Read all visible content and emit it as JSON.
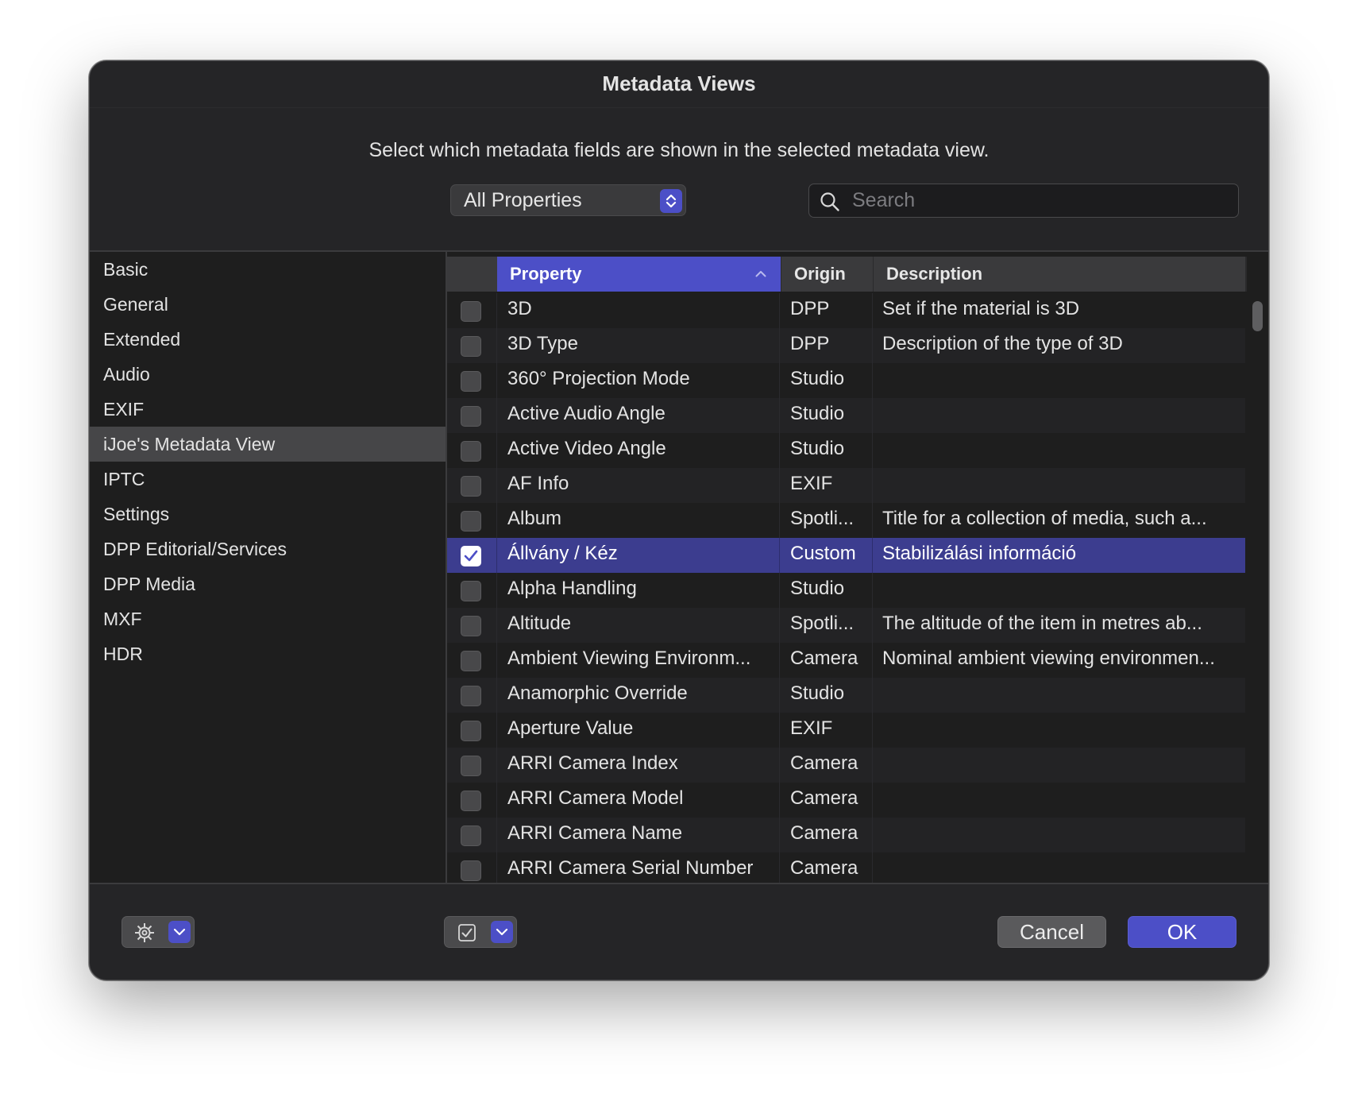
{
  "window": {
    "title": "Metadata Views",
    "instruction": "Select which metadata fields are shown in the selected metadata view."
  },
  "filter_popup": {
    "selected": "All Properties"
  },
  "search": {
    "placeholder": "Search",
    "value": ""
  },
  "sidebar": {
    "selected_index": 5,
    "items": [
      {
        "label": "Basic"
      },
      {
        "label": "General"
      },
      {
        "label": "Extended"
      },
      {
        "label": "Audio"
      },
      {
        "label": "EXIF"
      },
      {
        "label": "iJoe's Metadata View"
      },
      {
        "label": "IPTC"
      },
      {
        "label": "Settings"
      },
      {
        "label": "DPP Editorial/Services"
      },
      {
        "label": "DPP Media"
      },
      {
        "label": "MXF"
      },
      {
        "label": "HDR"
      }
    ]
  },
  "table": {
    "columns": {
      "property": "Property",
      "origin": "Origin",
      "description": "Description"
    },
    "sort": {
      "column": "property",
      "direction": "ascending"
    },
    "rows": [
      {
        "checked": false,
        "property": "3D",
        "origin": "DPP",
        "description": "Set if the material is 3D"
      },
      {
        "checked": false,
        "property": "3D Type",
        "origin": "DPP",
        "description": "Description of the type of 3D"
      },
      {
        "checked": false,
        "property": "360° Projection Mode",
        "origin": "Studio",
        "description": ""
      },
      {
        "checked": false,
        "property": "Active Audio Angle",
        "origin": "Studio",
        "description": ""
      },
      {
        "checked": false,
        "property": "Active Video Angle",
        "origin": "Studio",
        "description": ""
      },
      {
        "checked": false,
        "property": "AF Info",
        "origin": "EXIF",
        "description": ""
      },
      {
        "checked": false,
        "property": "Album",
        "origin": "Spotli...",
        "description": "Title for a collection of media, such a..."
      },
      {
        "checked": true,
        "selected": true,
        "property": "Állvány / Kéz",
        "origin": "Custom",
        "description": "Stabilizálási információ"
      },
      {
        "checked": false,
        "property": "Alpha Handling",
        "origin": "Studio",
        "description": ""
      },
      {
        "checked": false,
        "property": "Altitude",
        "origin": "Spotli...",
        "description": "The altitude of the item in metres ab..."
      },
      {
        "checked": false,
        "property": "Ambient Viewing Environm...",
        "origin": "Camera",
        "description": "Nominal ambient viewing environmen..."
      },
      {
        "checked": false,
        "property": "Anamorphic Override",
        "origin": "Studio",
        "description": ""
      },
      {
        "checked": false,
        "property": "Aperture Value",
        "origin": "EXIF",
        "description": ""
      },
      {
        "checked": false,
        "property": "ARRI Camera Index",
        "origin": "Camera",
        "description": ""
      },
      {
        "checked": false,
        "property": "ARRI Camera Model",
        "origin": "Camera",
        "description": ""
      },
      {
        "checked": false,
        "property": "ARRI Camera Name",
        "origin": "Camera",
        "description": ""
      },
      {
        "checked": false,
        "property": "ARRI Camera Serial Number",
        "origin": "Camera",
        "description": ""
      }
    ]
  },
  "footer": {
    "cancel_label": "Cancel",
    "ok_label": "OK"
  },
  "colors": {
    "accent": "#4c4fc7",
    "selected_row": "#3c3d8f",
    "window_bg": "#252527",
    "list_bg": "#1e1e1e"
  }
}
